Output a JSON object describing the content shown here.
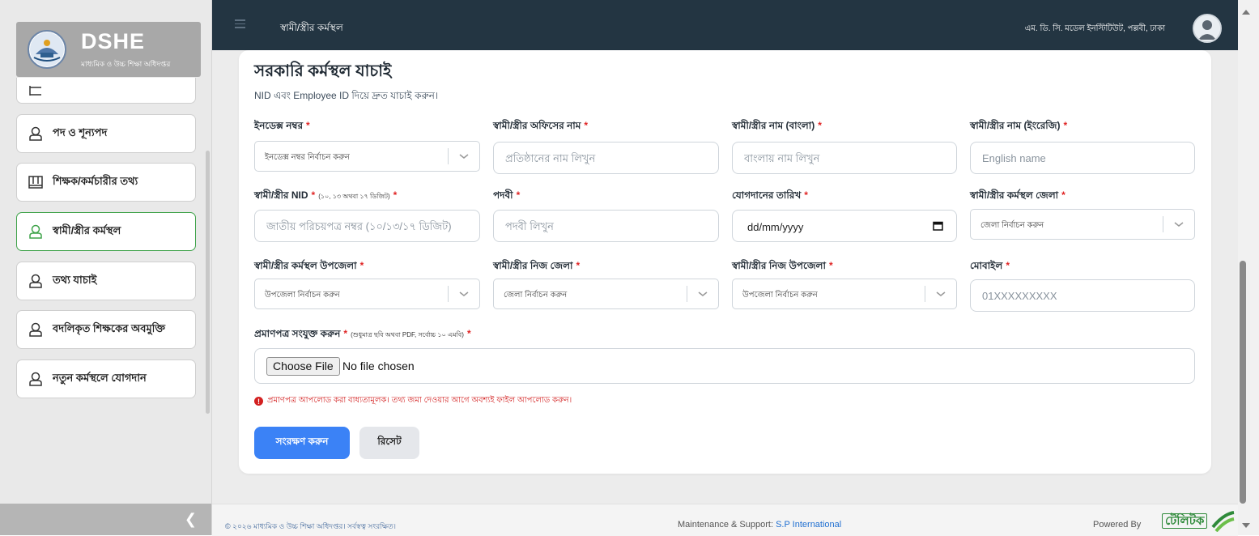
{
  "brand": {
    "title": "DSHE",
    "subtitle": "মাধ্যমিক ও উচ্চ শিক্ষা অধিদপ্তর"
  },
  "sidebar": {
    "items": [
      {
        "label": "",
        "icon": "list-icon",
        "active": false
      },
      {
        "label": "পদ ও শূন্যপদ",
        "icon": "user-icon",
        "active": false
      },
      {
        "label": "শিক্ষক/কর্মচারীর তথ্য",
        "icon": "book-icon",
        "active": false
      },
      {
        "label": "স্বামী/স্ত্রীর কর্মস্থল",
        "icon": "user-icon",
        "active": true
      },
      {
        "label": "তথ্য যাচাই",
        "icon": "user-icon",
        "active": false
      },
      {
        "label": "বদলিকৃত শিক্ষকের অবমুক্তি",
        "icon": "user-icon",
        "active": false
      },
      {
        "label": "নতুন কর্মস্থলে যোগদান",
        "icon": "user-icon",
        "active": false
      }
    ],
    "collapse_icon": "chevron-left-icon"
  },
  "topbar": {
    "title": "স্বামী/স্ত্রীর কর্মস্থল",
    "org": "এম. ডি. সি. মডেল ইনস্টিটিউট, পল্লবী, ঢাকা"
  },
  "form": {
    "title": "সরকারি কর্মস্থল যাচাই",
    "subtitle": "NID এবং Employee ID দিয়ে দ্রুত যাচাই করুন।",
    "required_mark": "*",
    "index_label": "ইনডেক্স নম্বর",
    "index_placeholder": "ইনডেক্স নম্বর নির্বাচন করুন",
    "office_label": "স্বামী/স্ত্রীর অফিসের নাম",
    "office_placeholder": "প্রতিষ্ঠানের নাম লিখুন",
    "name_bn_label": "স্বামী/স্ত্রীর নাম (বাংলা)",
    "name_bn_placeholder": "বাংলায় নাম লিখুন",
    "name_en_label": "স্বামী/স্ত্রীর নাম (ইংরেজি)",
    "name_en_placeholder": "English name",
    "nid_label": "স্বামী/স্ত্রীর NID",
    "nid_hint": "(১০, ১৩ অথবা ১৭ ডিজিট)",
    "nid_placeholder": "জাতীয় পরিচয়পত্র নম্বর (১০/১৩/১৭ ডিজিট)",
    "designation_label": "পদবী",
    "designation_placeholder": "পদবী লিখুন",
    "join_date_label": "যোগদানের তারিখ",
    "join_date_value": "dd/mm/yyyy",
    "district_label": "স্বামী/স্ত্রীর কর্মস্থল জেলা",
    "district_placeholder": "জেলা নির্বাচন করুন",
    "upazila_label": "স্বামী/স্ত্রীর কর্মস্থল উপজেলা",
    "upazila_placeholder": "উপজেলা নির্বাচন করুন",
    "home_district_label": "স্বামী/স্ত্রীর নিজ জেলা",
    "home_district_placeholder": "জেলা নির্বাচন করুন",
    "home_upazila_label": "স্বামী/স্ত্রীর নিজ উপজেলা",
    "home_upazila_placeholder": "উপজেলা নির্বাচন করুন",
    "mobile_label": "মোবাইল",
    "mobile_placeholder": "01XXXXXXXXX",
    "attach_label": "প্রমাণপত্র সংযুক্ত করুন",
    "attach_hint": "(শুধুমাত্র ছবি অথবা PDF, সর্বোচ্চ ১০ এমবি)",
    "file_button": "Choose File",
    "file_status": "No file chosen",
    "warning": "প্রমাণপত্র আপলোড করা বাধ্যতামূলক। তথ্য জমা দেওয়ার আগে অবশ্যই ফাইল আপলোড করুন।",
    "save_button": "সংরক্ষণ করুন",
    "reset_button": "রিসেট"
  },
  "footer": {
    "copyright": "© ২০২৬ মাধ্যমিক ও উচ্চ শিক্ষা অধিদপ্তর। সর্বস্বত্ব সংরক্ষিত।",
    "maintenance_label": "Maintenance & Support:",
    "maintenance_link": "S.P International",
    "powered_by": "Powered By",
    "powered_logo_text": "টেলিটক"
  },
  "colors": {
    "topbar": "#233542",
    "accent": "#3b82f6",
    "active_border": "#3fa34a",
    "required": "#e02424",
    "warning": "#d32020"
  }
}
